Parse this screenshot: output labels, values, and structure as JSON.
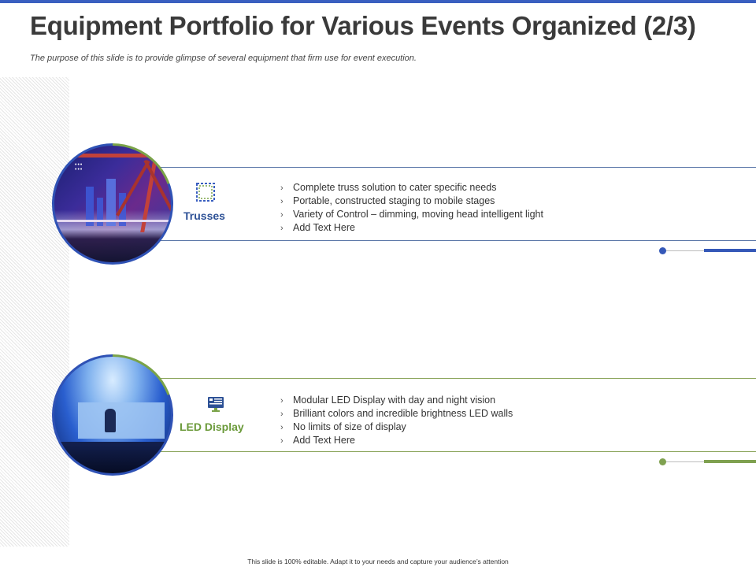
{
  "header": {
    "title": "Equipment Portfolio for Various Events Organized (2/3)",
    "subtitle": "The purpose of this slide is to provide glimpse of several equipment that firm use for event execution."
  },
  "colors": {
    "accent_blue": "#3a5fc0",
    "accent_green": "#7aa348"
  },
  "items": [
    {
      "label": "Trusses",
      "icon": "truss-frame-icon",
      "bullets": [
        "Complete truss solution to cater specific needs",
        "Portable, constructed staging to mobile stages",
        "Variety of Control – dimming, moving head intelligent light",
        "Add Text Here"
      ]
    },
    {
      "label": "LED Display",
      "icon": "monitor-icon",
      "bullets": [
        "Modular LED Display with day and night vision",
        "Brilliant colors and incredible brightness LED walls",
        "No limits of size of display",
        "Add Text Here"
      ]
    }
  ],
  "bullet_glyph": "›",
  "footer": "This slide is 100% editable. Adapt it to your needs and capture your audience’s attention"
}
